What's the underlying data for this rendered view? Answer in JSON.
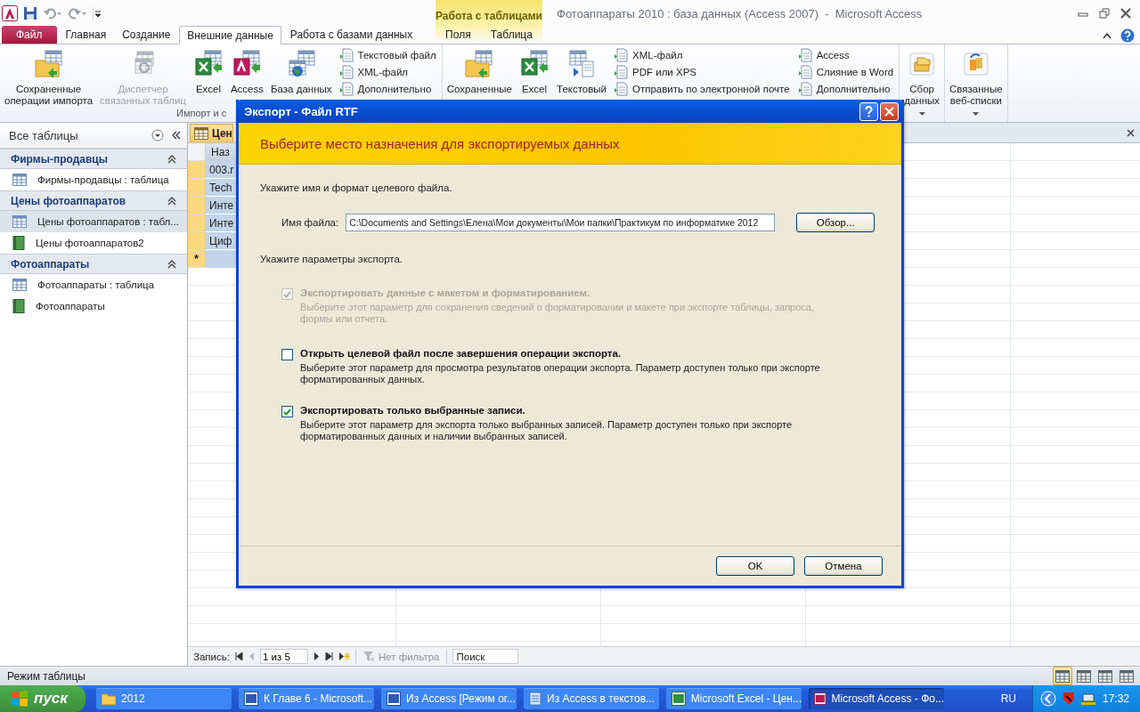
{
  "window": {
    "title": "Фотоаппараты 2010 : база данных (Access 2007)  -  Microsoft Access",
    "context_group": "Работа с таблицами"
  },
  "ribbon_tabs": [
    {
      "label": "Файл",
      "kind": "file",
      "selected": false
    },
    {
      "label": "Главная",
      "kind": "normal",
      "selected": false
    },
    {
      "label": "Создание",
      "kind": "normal",
      "selected": false
    },
    {
      "label": "Внешние данные",
      "kind": "normal",
      "selected": true
    },
    {
      "label": "Работа с базами данных",
      "kind": "normal",
      "selected": false
    },
    {
      "label": "Поля",
      "kind": "context",
      "selected": false
    },
    {
      "label": "Таблица",
      "kind": "context",
      "selected": false
    }
  ],
  "ribbon": [
    {
      "label": "Импорт и с",
      "items": [
        {
          "kind": "large",
          "label": "Сохраненные\nоперации импорта",
          "disabled": false
        },
        {
          "kind": "large",
          "label": "Диспетчер\nсвязанных таблиц",
          "disabled": true
        },
        {
          "kind": "large",
          "label": "Excel",
          "disabled": false
        },
        {
          "kind": "large",
          "label": "Access",
          "disabled": false
        },
        {
          "kind": "large",
          "label": "База данных",
          "disabled": false
        },
        {
          "kind": "stack",
          "items": [
            {
              "label": "Текстовый файл"
            },
            {
              "label": "XML-файл"
            },
            {
              "label": "Дополнительно"
            }
          ]
        }
      ]
    },
    {
      "items": [
        {
          "kind": "large",
          "label": "Сохраненные",
          "disabled": false
        },
        {
          "kind": "large",
          "label": "Excel",
          "disabled": false
        },
        {
          "kind": "large",
          "label": "Текстовый",
          "disabled": false
        },
        {
          "kind": "stack",
          "items": [
            {
              "label": "XML-файл"
            },
            {
              "label": "PDF или XPS"
            },
            {
              "label": "Отправить по электронной почте"
            }
          ]
        },
        {
          "kind": "stack",
          "items": [
            {
              "label": "Access"
            },
            {
              "label": "Слияние в Word"
            },
            {
              "label": "Дополнительно"
            }
          ]
        }
      ]
    },
    {
      "items": [
        {
          "kind": "dropdown",
          "label": "Сбор\nданных",
          "disabled": false
        }
      ]
    },
    {
      "items": [
        {
          "kind": "dropdown",
          "label": "Связанные\nвеб-списки",
          "disabled": false
        }
      ]
    }
  ],
  "nav": {
    "title": "Все таблицы",
    "groups": [
      {
        "title": "Фирмы-продавцы",
        "expanded": true,
        "items": [
          {
            "label": "Фирмы-продавцы : таблица",
            "kind": "table",
            "selected": false
          }
        ]
      },
      {
        "title": "Цены фотоаппаратов",
        "expanded": true,
        "items": [
          {
            "label": "Цены фотоаппаратов : табл...",
            "kind": "table",
            "selected": true
          },
          {
            "label": "Цены фотоаппаратов2",
            "kind": "report",
            "selected": false
          }
        ]
      },
      {
        "title": "Фотоаппараты",
        "expanded": true,
        "items": [
          {
            "label": "Фотоаппараты : таблица",
            "kind": "table",
            "selected": false
          },
          {
            "label": "Фотоаппараты",
            "kind": "report",
            "selected": false
          }
        ]
      }
    ]
  },
  "document": {
    "tab": "Цен",
    "columns": [
      "Наз"
    ],
    "rows": [
      {
        "cells": [
          "003.r"
        ],
        "selected": true
      },
      {
        "cells": [
          "Tech"
        ],
        "selected": true
      },
      {
        "cells": [
          "Инте"
        ],
        "selected": true
      },
      {
        "cells": [
          "Инте"
        ],
        "selected": true
      },
      {
        "cells": [
          "Циф"
        ],
        "selected": true
      }
    ],
    "new_row_marker": "*"
  },
  "record_nav": {
    "label": "Запись:",
    "position": "1 из 5",
    "filter": "Нет фильтра",
    "search_placeholder": "Поиск"
  },
  "status_bar": {
    "text": "Режим таблицы",
    "views": [
      {
        "selected": true
      },
      {
        "selected": false
      },
      {
        "selected": false
      },
      {
        "selected": false
      }
    ]
  },
  "dialog": {
    "title": "Экспорт - Файл RTF",
    "heading": "Выберите место назначения для экспортируемых данных",
    "intro": "Укажите имя и формат целевого файла.",
    "file_label": "Имя файла:",
    "file_value": "C:\\Documents and Settings\\Елена\\Мои документы\\Мои папки\\Практикум по информатике 2012",
    "browse": "Обзор...",
    "options_label": "Укажите параметры экспорта.",
    "options": [
      {
        "label": "Экспортировать данные с макетом и форматированием.",
        "description": "Выберите этот параметр для сохранения сведений о форматировании и макете при экспорте таблицы, запроса, формы или отчета.",
        "checked": true,
        "disabled": true
      },
      {
        "label": "Открыть целевой файл после завершения операции экспорта.",
        "description": "Выберите этот параметр для просмотра результатов операции экспорта. Параметр доступен только при экспорте форматированных данных.",
        "checked": false,
        "disabled": false
      },
      {
        "label": "Экспортировать только выбранные записи.",
        "description": "Выберите этот параметр для экспорта только выбранных записей. Параметр доступен только при экспорте форматированных данных и наличии выбранных записей.",
        "checked": true,
        "disabled": false
      }
    ],
    "buttons": [
      "OK",
      "Отмена"
    ]
  },
  "taskbar": {
    "start": "пуск",
    "items": [
      {
        "label": "2012",
        "kind": "folder",
        "selected": false
      },
      {
        "label": "К Главе 6 - Microsoft...",
        "kind": "word",
        "selected": false
      },
      {
        "label": "Из Access [Режим ог...",
        "kind": "word",
        "selected": false
      },
      {
        "label": "Из Access в текстов...",
        "kind": "notepad",
        "selected": false
      },
      {
        "label": "Microsoft Excel - Цен...",
        "kind": "excel",
        "selected": false
      },
      {
        "label": "Microsoft Access - Фо...",
        "kind": "access",
        "selected": true
      }
    ],
    "language": "RU",
    "clock": "17:32"
  }
}
